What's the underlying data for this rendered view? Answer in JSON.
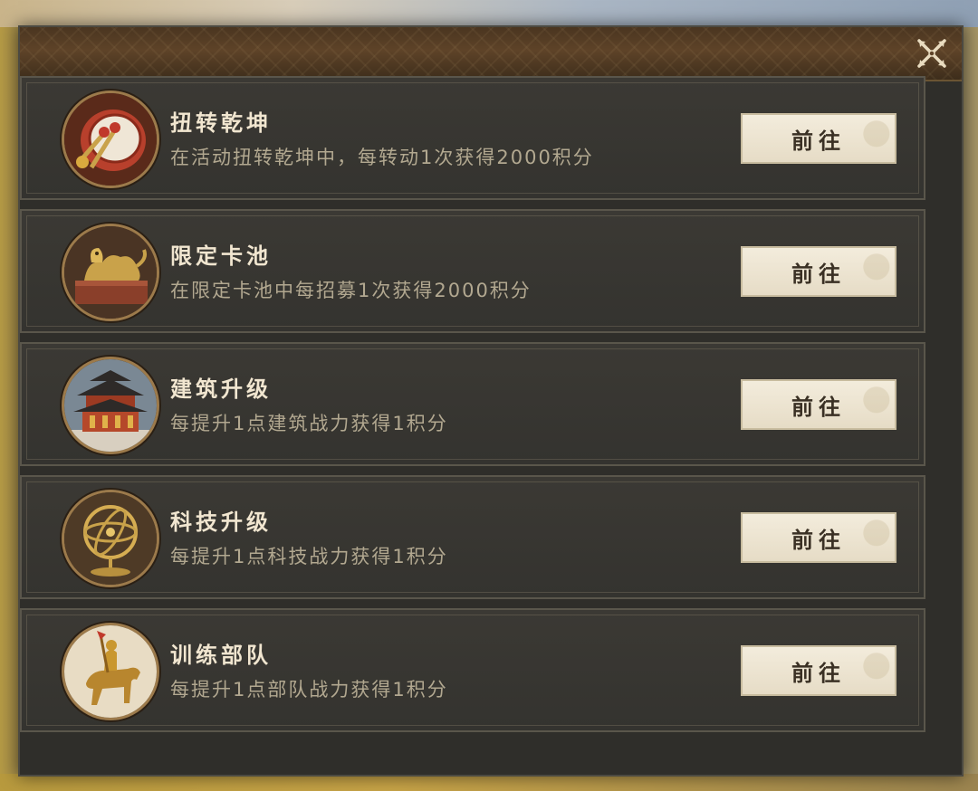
{
  "dialog": {
    "close_icon": "crossed-close-icon",
    "colors": {
      "panel": "#2f2e2a",
      "header": "#5e4328",
      "title_text": "#f1e6d0",
      "desc_text": "#b2a890",
      "button_bg": "#ece3cf"
    }
  },
  "tasks": [
    {
      "icon": "war-drum-icon",
      "title": "扭转乾坤",
      "description": "在活动扭转乾坤中，每转动1次获得2000积分",
      "button_label": "前往"
    },
    {
      "icon": "golden-beast-seal-icon",
      "title": "限定卡池",
      "description": "在限定卡池中每招募1次获得2000积分",
      "button_label": "前往"
    },
    {
      "icon": "palace-building-icon",
      "title": "建筑升级",
      "description": "每提升1点建筑战力获得1积分",
      "button_label": "前往"
    },
    {
      "icon": "armillary-sphere-icon",
      "title": "科技升级",
      "description": "每提升1点科技战力获得1积分",
      "button_label": "前往"
    },
    {
      "icon": "horseback-warrior-icon",
      "title": "训练部队",
      "description": "每提升1点部队战力获得1积分",
      "button_label": "前往"
    }
  ]
}
